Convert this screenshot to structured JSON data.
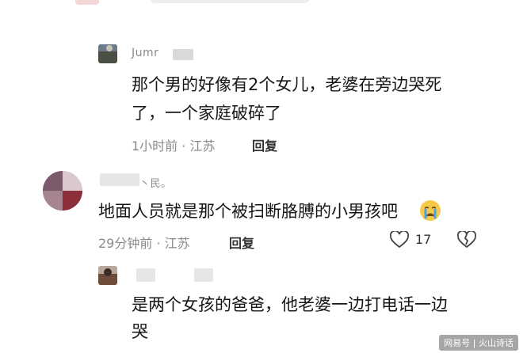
{
  "comments": [
    {
      "username": "Jumr",
      "text_line1": "那个男的好像有2个女儿，老婆在旁边哭死",
      "text_line2": "了，一个家庭破碎了",
      "meta": "1小时前 · 江苏",
      "reply_label": "回复"
    },
    {
      "username": "丶民。",
      "text": "地面人员就是那个被扫断胳膊的小男孩吧",
      "emoji": "😭",
      "meta": "29分钟前 · 江苏",
      "reply_label": "回复",
      "like_count": "17"
    },
    {
      "text_line1": "是两个女孩的爸爸，他老婆一边打电话一边",
      "text_line2": "哭"
    }
  ],
  "watermark": "网易号 | 火山诗话",
  "colors": {
    "like_icon": "#444444",
    "emoji_bg": "#f7c948"
  }
}
